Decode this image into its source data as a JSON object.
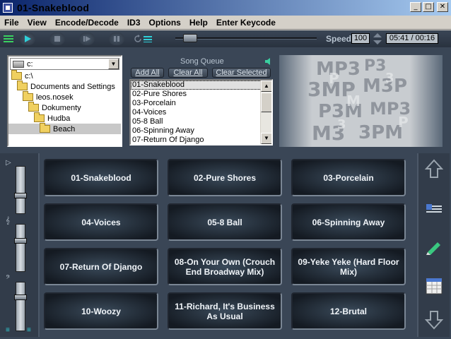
{
  "window": {
    "title": "01-Snakeblood"
  },
  "window_buttons": {
    "minimize": "_",
    "maximize": "□",
    "close": "✕"
  },
  "menu": [
    "File",
    "View",
    "Encode/Decode",
    "ID3",
    "Options",
    "Help",
    "Enter Keycode"
  ],
  "transport": {
    "speed_label": "Speed",
    "speed_value": "100",
    "time": "05:41 / 00:16",
    "position_fraction": 0.05
  },
  "folders": {
    "drive": "c:",
    "tree": [
      {
        "label": "c:\\",
        "indent": 0
      },
      {
        "label": "Documents and Settings",
        "indent": 1
      },
      {
        "label": "leos.nosek",
        "indent": 2
      },
      {
        "label": "Dokumenty",
        "indent": 3
      },
      {
        "label": "Hudba",
        "indent": 4
      },
      {
        "label": "Beach",
        "indent": 5,
        "selected": true
      }
    ]
  },
  "queue": {
    "title": "Song Queue",
    "add_all": "Add All",
    "clear_all": "Clear All",
    "clear_selected": "Clear Selected",
    "items": [
      "01-Snakeblood",
      "02-Pure Shores",
      "03-Porcelain",
      "04-Voices",
      "05-8 Ball",
      "06-Spinning Away",
      "07-Return Of Django"
    ],
    "selected_index": 0
  },
  "tracks": [
    "01-Snakeblood",
    "02-Pure Shores",
    "03-Porcelain",
    "04-Voices",
    "05-8 Ball",
    "06-Spinning Away",
    "07-Return Of Django",
    "08-On Your Own (Crouch End Broadway Mix)",
    "09-Yeke Yeke (Hard Floor Mix)",
    "10-Woozy",
    "11-Richard, It's Business As Usual",
    "12-Brutal"
  ],
  "colors": {
    "panel": "#3a4656",
    "button_text": "#f0f4f8",
    "accent_play": "#2fd0d8"
  }
}
